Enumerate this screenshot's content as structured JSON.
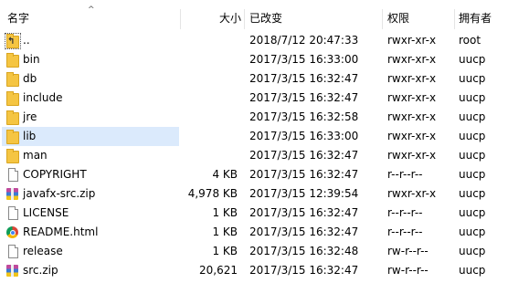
{
  "columns": {
    "name": "名字",
    "size": "大小",
    "modified": "已改变",
    "permissions": "权限",
    "owner": "拥有者"
  },
  "files": [
    {
      "name": "..",
      "size": "",
      "modified": "2018/7/12 20:47:33",
      "permissions": "rwxr-xr-x",
      "owner": "root",
      "icon": "parent-folder-icon"
    },
    {
      "name": "bin",
      "size": "",
      "modified": "2017/3/15 16:33:00",
      "permissions": "rwxr-xr-x",
      "owner": "uucp",
      "icon": "folder-icon"
    },
    {
      "name": "db",
      "size": "",
      "modified": "2017/3/15 16:32:47",
      "permissions": "rwxr-xr-x",
      "owner": "uucp",
      "icon": "folder-icon"
    },
    {
      "name": "include",
      "size": "",
      "modified": "2017/3/15 16:32:47",
      "permissions": "rwxr-xr-x",
      "owner": "uucp",
      "icon": "folder-icon"
    },
    {
      "name": "jre",
      "size": "",
      "modified": "2017/3/15 16:32:58",
      "permissions": "rwxr-xr-x",
      "owner": "uucp",
      "icon": "folder-icon"
    },
    {
      "name": "lib",
      "size": "",
      "modified": "2017/3/15 16:33:00",
      "permissions": "rwxr-xr-x",
      "owner": "uucp",
      "icon": "folder-icon"
    },
    {
      "name": "man",
      "size": "",
      "modified": "2017/3/15 16:32:47",
      "permissions": "rwxr-xr-x",
      "owner": "uucp",
      "icon": "folder-icon"
    },
    {
      "name": "COPYRIGHT",
      "size": "4 KB",
      "modified": "2017/3/15 16:32:47",
      "permissions": "r--r--r--",
      "owner": "uucp",
      "icon": "document-icon"
    },
    {
      "name": "javafx-src.zip",
      "size": "4,978 KB",
      "modified": "2017/3/15 12:39:54",
      "permissions": "rwxr-xr-x",
      "owner": "uucp",
      "icon": "zip-archive-icon"
    },
    {
      "name": "LICENSE",
      "size": "1 KB",
      "modified": "2017/3/15 16:32:47",
      "permissions": "r--r--r--",
      "owner": "uucp",
      "icon": "document-icon"
    },
    {
      "name": "README.html",
      "size": "1 KB",
      "modified": "2017/3/15 16:32:47",
      "permissions": "r--r--r--",
      "owner": "uucp",
      "icon": "chrome-html-icon"
    },
    {
      "name": "release",
      "size": "1 KB",
      "modified": "2017/3/15 16:32:48",
      "permissions": "rw-r--r--",
      "owner": "uucp",
      "icon": "document-icon"
    },
    {
      "name": "src.zip",
      "size": "20,621",
      "modified": "2017/3/15 16:32:47",
      "permissions": "rw-r--r--",
      "owner": "uucp",
      "icon": "zip-archive-icon"
    }
  ],
  "selected_row": 5,
  "colors": {
    "selection": "#dbeafc",
    "folder": "#f5c542"
  }
}
